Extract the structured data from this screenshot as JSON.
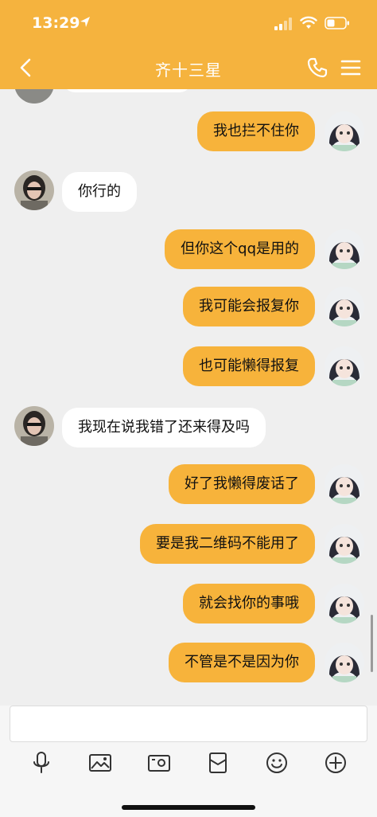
{
  "status_bar": {
    "time": "13:29"
  },
  "header": {
    "title": "齐十三星"
  },
  "colors": {
    "accent": "#f5b33e",
    "outgoing_bubble": "#f7b33b",
    "incoming_bubble": "#ffffff"
  },
  "messages": [
    {
      "direction": "out",
      "text": "我也拦不住你"
    },
    {
      "direction": "in",
      "text": "你行的"
    },
    {
      "direction": "out",
      "text": "但你这个qq是用的"
    },
    {
      "direction": "out",
      "text": "我可能会报复你"
    },
    {
      "direction": "out",
      "text": "也可能懒得报复"
    },
    {
      "direction": "in",
      "text": "我现在说我错了还来得及吗"
    },
    {
      "direction": "out",
      "text": "好了我懒得废话了"
    },
    {
      "direction": "out",
      "text": "要是我二维码不能用了"
    },
    {
      "direction": "out",
      "text": "就会找你的事哦"
    },
    {
      "direction": "out",
      "text": "不管是不是因为你"
    }
  ],
  "input": {
    "value": "",
    "placeholder": ""
  },
  "toolbar": [
    "microphone-icon",
    "image-icon",
    "camera-icon",
    "red-packet-icon",
    "emoji-icon",
    "plus-icon"
  ]
}
